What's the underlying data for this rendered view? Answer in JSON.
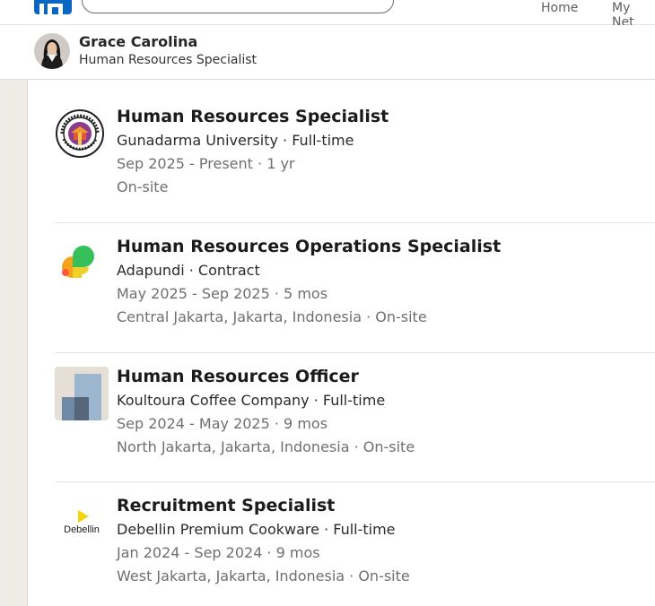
{
  "nav": {
    "items": [
      {
        "label": "Home"
      },
      {
        "label": "My Net"
      }
    ]
  },
  "profile": {
    "name": "Grace Carolina",
    "headline": "Human Resources Specialist"
  },
  "experience": [
    {
      "title": "Human Resources Specialist",
      "company": "Gunadarma University · Full-time",
      "dates": "Sep 2025 - Present · 1 yr",
      "location": "On-site",
      "logo": "gunadarma-university-seal-icon"
    },
    {
      "title": "Human Resources Operations Specialist",
      "company": "Adapundi · Contract",
      "dates": "May 2025 - Sep 2025 · 5 mos",
      "location": "Central Jakarta, Jakarta, Indonesia · On-site",
      "logo": "adapundi-logo-icon"
    },
    {
      "title": "Human Resources Officer",
      "company": "Koultoura Coffee Company · Full-time",
      "dates": "Sep 2024 - May 2025 · 9 mos",
      "location": "North Jakarta, Jakarta, Indonesia · On-site",
      "logo": "building-placeholder-icon"
    },
    {
      "title": "Recruitment Specialist",
      "company": "Debellin Premium Cookware · Full-time",
      "dates": "Jan 2024 - Sep 2024 · 9 mos",
      "location": "West Jakarta, Jakarta, Indonesia · On-site",
      "logo": "debellin-logo-icon"
    }
  ],
  "debellin_logo_text": "Debellin",
  "colors": {
    "brand": "#0a66c2",
    "title_text": "#1b1b1b",
    "muted_text": "#6f6f6f",
    "page_background": "#f4f2ee"
  }
}
